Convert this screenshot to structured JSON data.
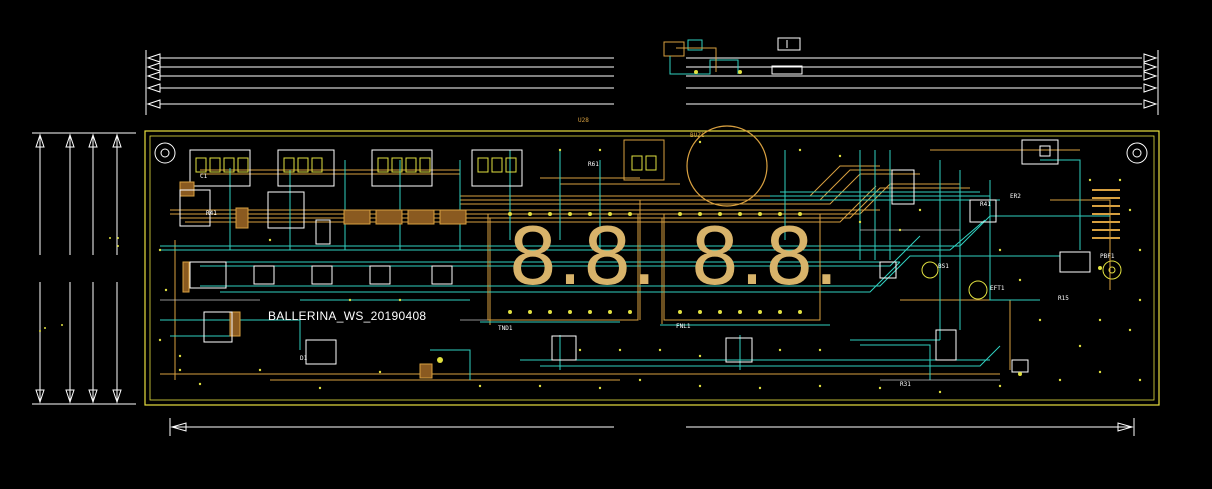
{
  "board": {
    "label": "BALLERINA_WS_20190408",
    "display_left": "8.8.",
    "display_right": "8.8.",
    "top_marker": "U28",
    "connector_left": "TND1",
    "connector_right": "FNL1"
  },
  "colors": {
    "background": "#000000",
    "outline": "#e8e040",
    "copper_top": "#d8a040",
    "copper_bottom": "#30d0c0",
    "silk": "#ffffff",
    "pad": "#e0e040",
    "segment": "#d8b36a"
  }
}
